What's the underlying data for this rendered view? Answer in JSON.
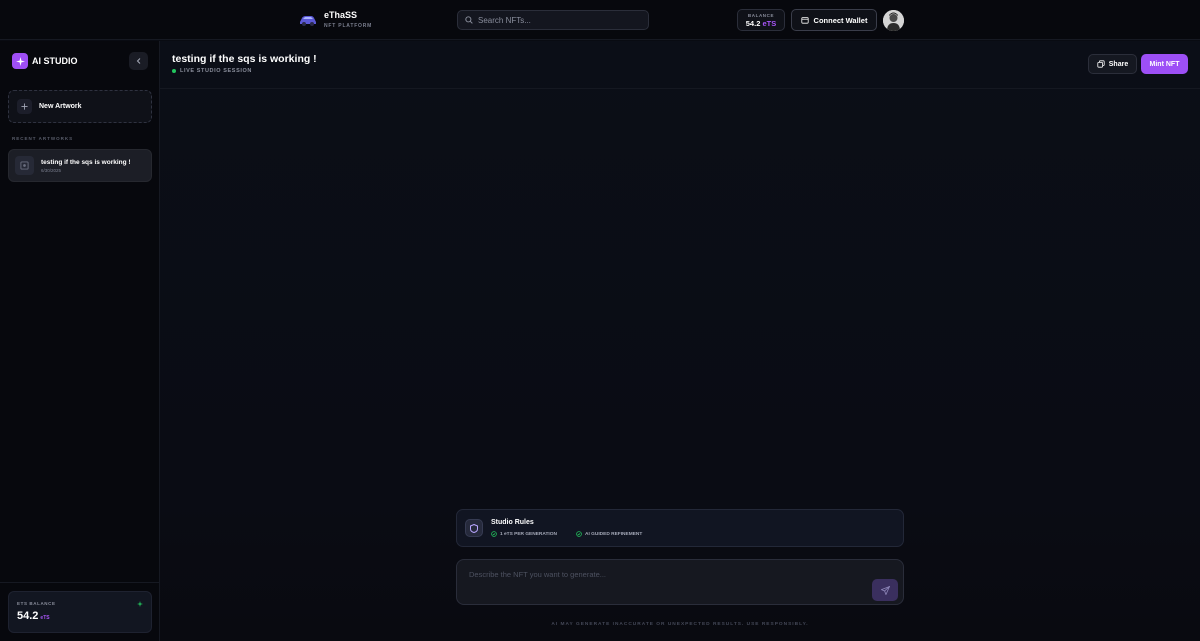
{
  "topbar": {
    "brand_name": "eThaSS",
    "brand_sub": "NFT PLATFORM",
    "search_placeholder": "Search NFTs...",
    "balance_label": "BALANCE",
    "balance_value": "54.2",
    "balance_currency": "eTS",
    "connect_label": "Connect Wallet",
    "icons": {
      "brand": "car-logo-icon",
      "search": "search-icon",
      "wallet": "wallet-icon",
      "avatar": "user-avatar"
    }
  },
  "sidebar": {
    "title": "AI STUDIO",
    "new_artwork": "New Artwork",
    "recent_label": "RECENT ARTWORKS",
    "recent": [
      {
        "title": "testing if the sqs is working !",
        "date": "6/30/2025"
      }
    ],
    "balance": {
      "label": "ETS BALANCE",
      "value": "54.2",
      "currency": "eTS"
    },
    "icons": {
      "logo": "sparkle-icon",
      "collapse": "chevron-left-icon",
      "new": "plus-icon",
      "recent": "image-icon",
      "balance": "sparkle-icon"
    }
  },
  "session": {
    "title": "testing if the sqs is working !",
    "status": "LIVE STUDIO SESSION",
    "status_color": "#22c55e",
    "share_label": "Share",
    "mint_label": "Mint NFT",
    "accent": "#9d4ff6"
  },
  "rules": {
    "title": "Studio Rules",
    "items": [
      "1 eTS PER GENERATION",
      "AI GUIDED REFINEMENT"
    ]
  },
  "prompt": {
    "placeholder": "Describe the NFT you want to generate...",
    "value": ""
  },
  "disclaimer": "AI MAY GENERATE INACCURATE OR UNEXPECTED RESULTS. USE RESPONSIBLY."
}
